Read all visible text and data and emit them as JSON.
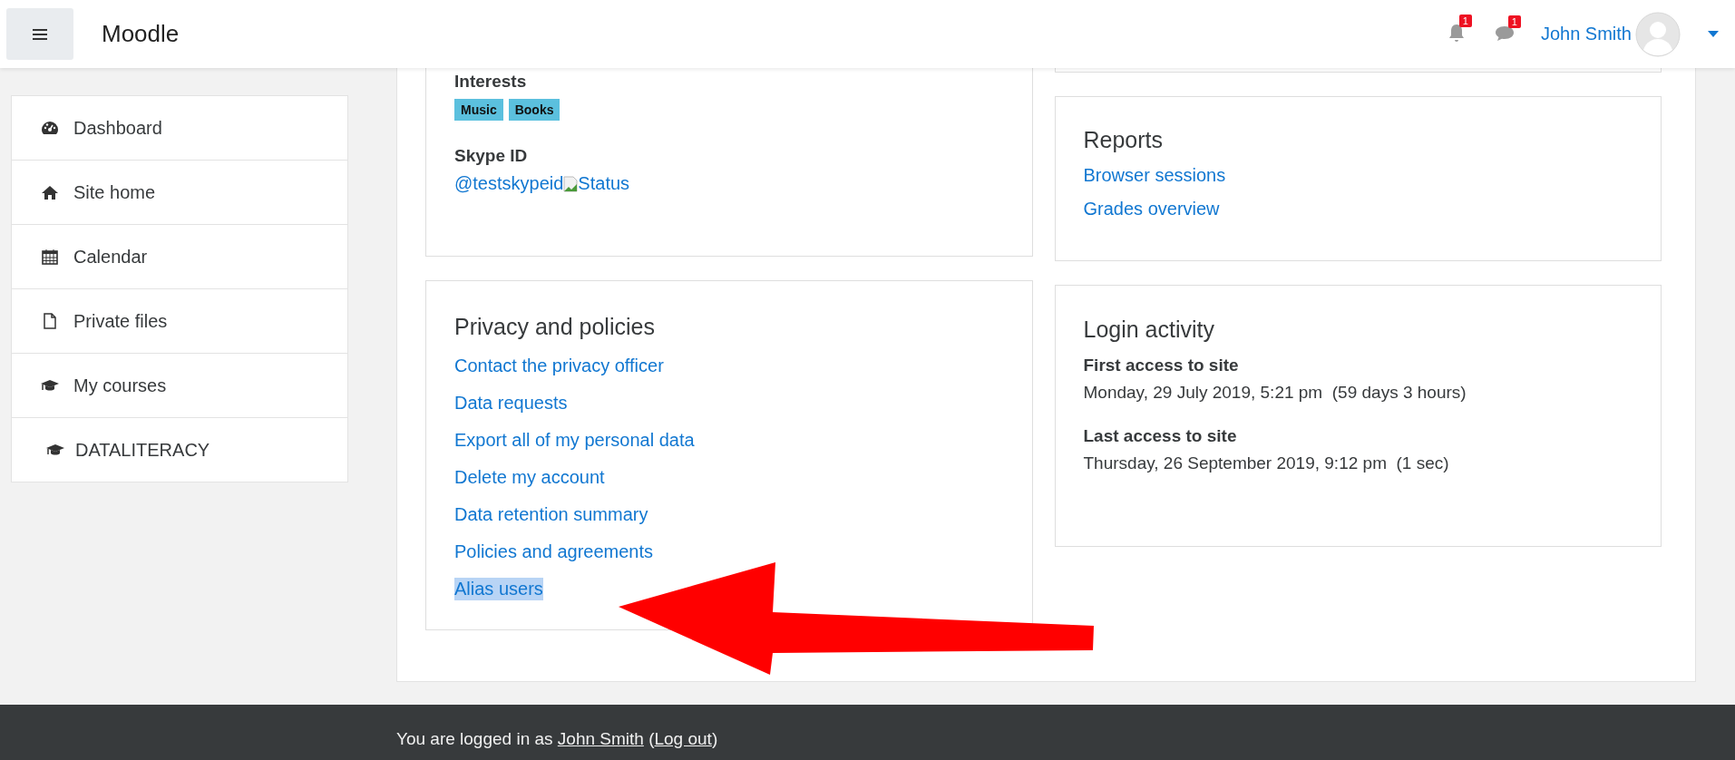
{
  "header": {
    "site_name": "Moodle",
    "notifications": [
      {
        "kind": "bell",
        "count": "1"
      },
      {
        "kind": "chat",
        "count": "1"
      }
    ],
    "user_name": "John Smith"
  },
  "sidebar": {
    "items": [
      {
        "label": "Dashboard",
        "kind": "dashboard"
      },
      {
        "label": "Site home",
        "kind": "home"
      },
      {
        "label": "Calendar",
        "kind": "calendar"
      },
      {
        "label": "Private files",
        "kind": "file"
      },
      {
        "label": "My courses",
        "kind": "course",
        "children": [
          {
            "label": "DATALITERACY",
            "kind": "course"
          }
        ]
      }
    ]
  },
  "profile_card": {
    "interests": {
      "label": "Interests",
      "tags": [
        "Music",
        "Books"
      ]
    },
    "skype": {
      "label": "Skype ID",
      "value": "@testskypeid",
      "status_alt": "Status"
    }
  },
  "privacy_card": {
    "title": "Privacy and policies",
    "links": [
      {
        "label": "Contact the privacy officer",
        "highlighted": false
      },
      {
        "label": "Data requests",
        "highlighted": false
      },
      {
        "label": "Export all of my personal data",
        "highlighted": false
      },
      {
        "label": "Delete my account",
        "highlighted": false
      },
      {
        "label": "Data retention summary",
        "highlighted": false
      },
      {
        "label": "Policies and agreements",
        "highlighted": false
      },
      {
        "label": "Alias users",
        "highlighted": true
      }
    ]
  },
  "reports_card": {
    "title": "Reports",
    "links": [
      "Browser sessions",
      "Grades overview"
    ]
  },
  "login_card": {
    "title": "Login activity",
    "entries": [
      {
        "label": "First access to site",
        "value": "Monday, 29 July 2019, 5:21 pm  (59 days 3 hours)"
      },
      {
        "label": "Last access to site",
        "value": "Thursday, 26 September 2019, 9:12 pm  (1 sec)"
      }
    ]
  },
  "footer": {
    "parts": [
      {
        "kind": "text",
        "text": "You are logged in as "
      },
      {
        "kind": "link",
        "text": "John Smith"
      },
      {
        "kind": "text",
        "text": " ("
      },
      {
        "kind": "link",
        "text": "Log out"
      },
      {
        "kind": "text",
        "text": ")"
      }
    ]
  },
  "annotation": {
    "kind": "arrow"
  }
}
